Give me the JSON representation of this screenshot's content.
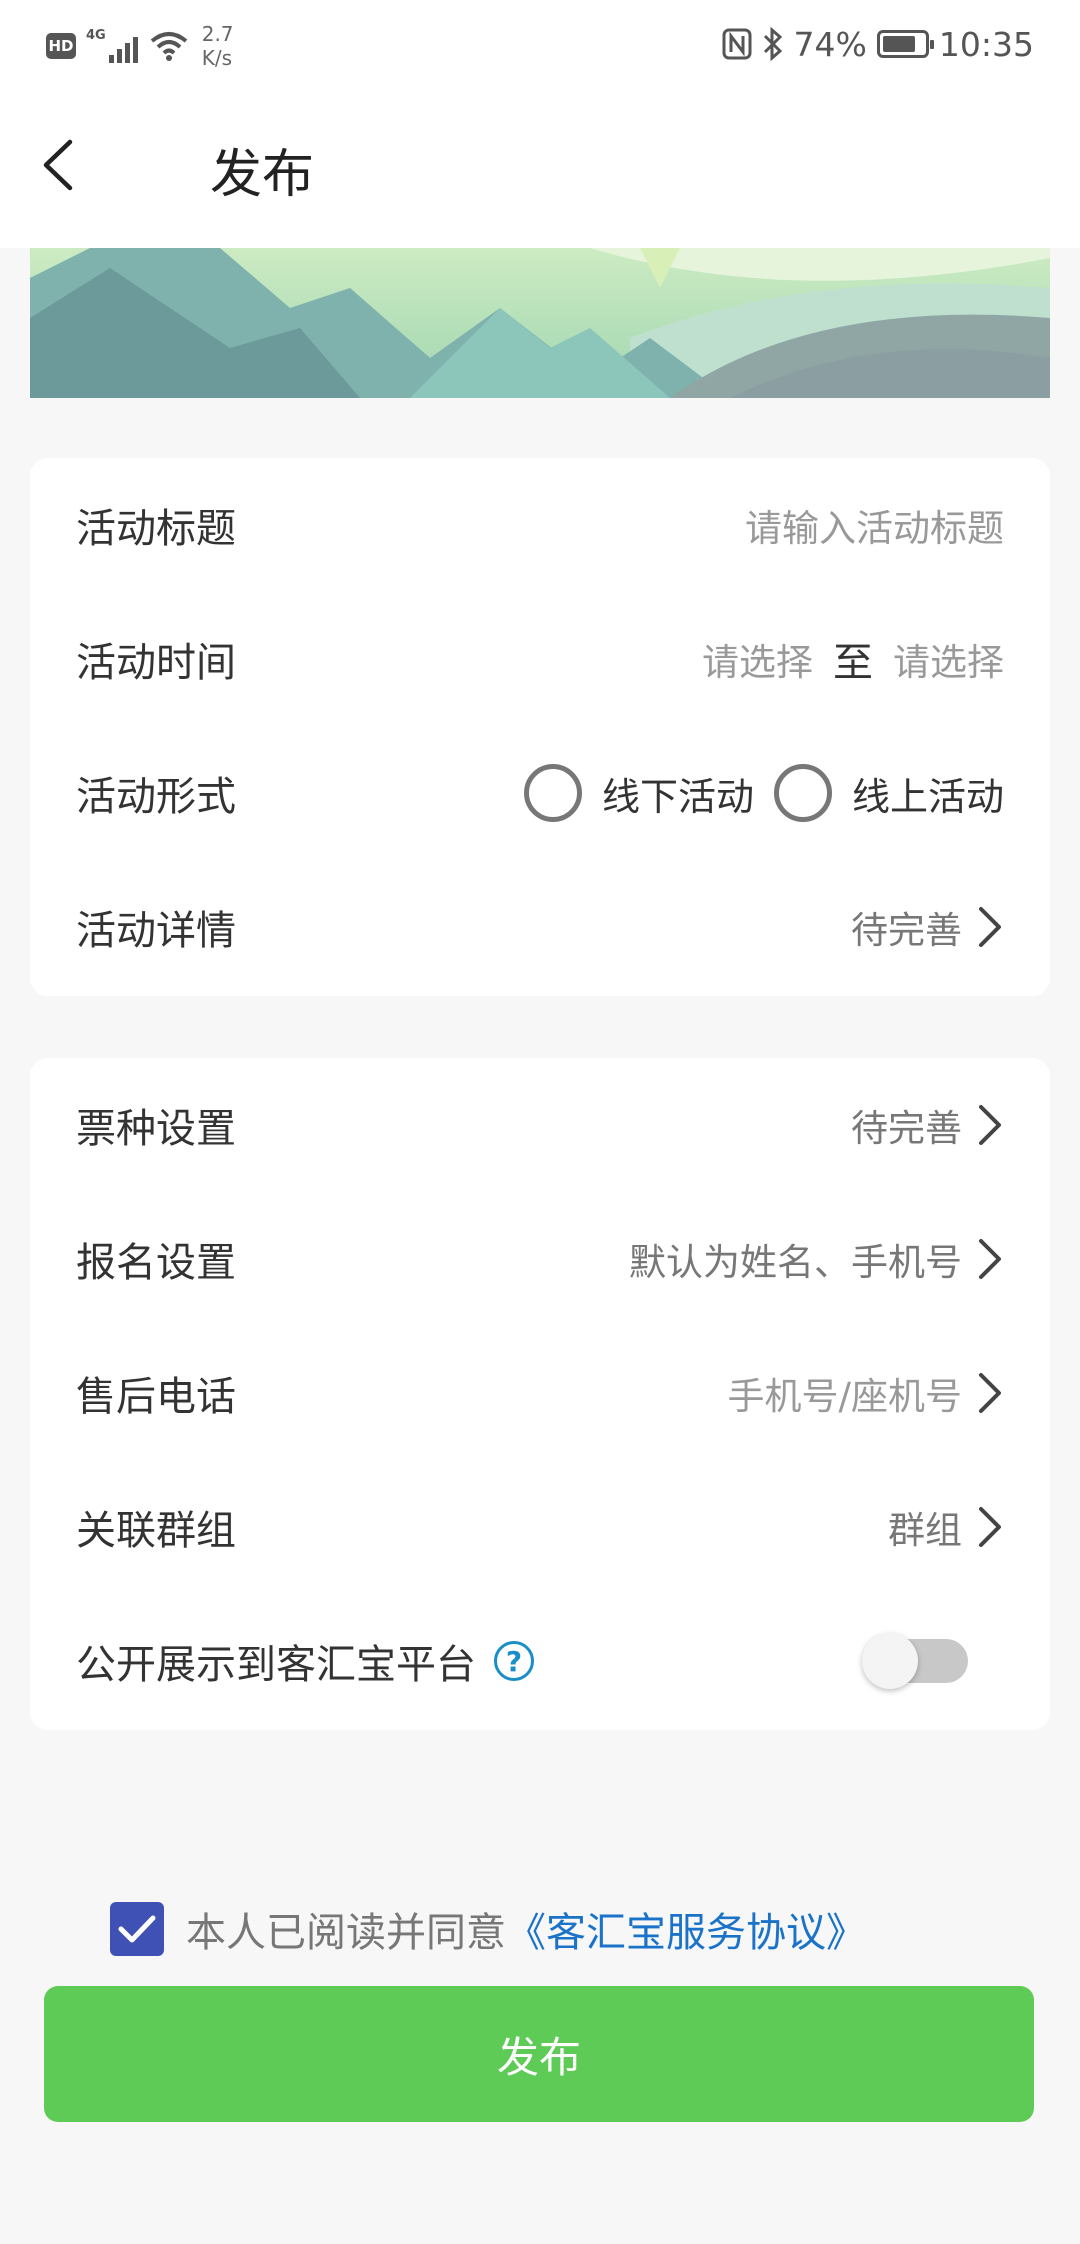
{
  "status_bar": {
    "hd": "HD",
    "network": "4G",
    "speed_value": "2.7",
    "speed_unit": "K/s",
    "battery": "74%",
    "time": "10:35"
  },
  "header": {
    "title": "发布"
  },
  "form1": {
    "title_label": "活动标题",
    "title_placeholder": "请输入活动标题",
    "time_label": "活动时间",
    "time_start": "请选择",
    "time_sep": "至",
    "time_end": "请选择",
    "format_label": "活动形式",
    "format_offline": "线下活动",
    "format_online": "线上活动",
    "details_label": "活动详情",
    "details_value": "待完善"
  },
  "form2": {
    "ticket_label": "票种设置",
    "ticket_value": "待完善",
    "signup_label": "报名设置",
    "signup_value": "默认为姓名、手机号",
    "phone_label": "售后电话",
    "phone_value": "手机号/座机号",
    "group_label": "关联群组",
    "group_value": "群组",
    "public_label": "公开展示到客汇宝平台",
    "public_enabled": false
  },
  "agreement": {
    "checked": true,
    "text": "本人已阅读并同意",
    "link": "《客汇宝服务协议》"
  },
  "publish_button": "发布",
  "colors": {
    "primary_green": "#5ecb56",
    "link_blue": "#1a73c9",
    "checkbox_blue": "#3f51b5"
  }
}
